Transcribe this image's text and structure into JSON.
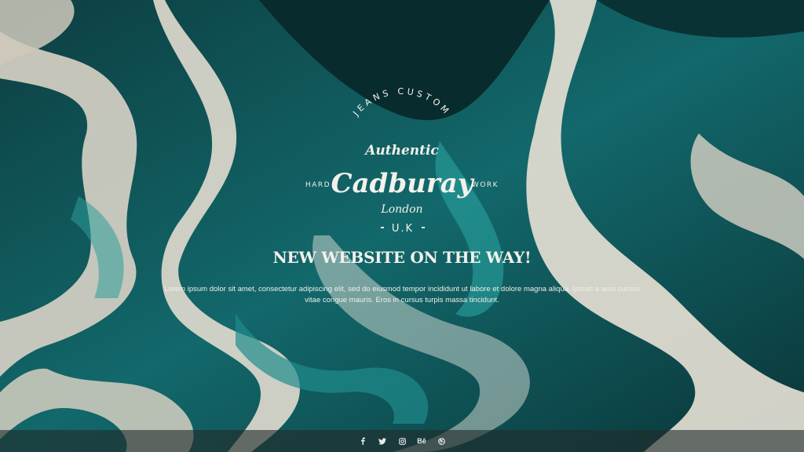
{
  "brand": {
    "arc_text": "JEANS CUSTOM",
    "tagline": "Authentic",
    "left_word": "HARD",
    "right_word": "WORK",
    "name": "Cadburay",
    "city": "London",
    "country": "U.K"
  },
  "hero": {
    "headline": "NEW WEBSITE ON THE WAY!",
    "body": "Lorem ipsum dolor sit amet, consectetur adipiscing elit, sed do eiusmod tempor incididunt ut labore et dolore magna aliqua. Ipsum a arcu cursus vitae congue mauris. Eros in cursus turpis massa tincidunt."
  },
  "footer": {
    "social": [
      {
        "icon": "facebook-icon"
      },
      {
        "icon": "twitter-icon"
      },
      {
        "icon": "instagram-icon"
      },
      {
        "icon": "behance-icon",
        "label": "Bē"
      },
      {
        "icon": "dribbble-icon"
      }
    ]
  },
  "colors": {
    "teal_dark": "#0b3f42",
    "teal": "#16777a",
    "cream": "#e7e1d6",
    "text": "#f3f1ec"
  }
}
